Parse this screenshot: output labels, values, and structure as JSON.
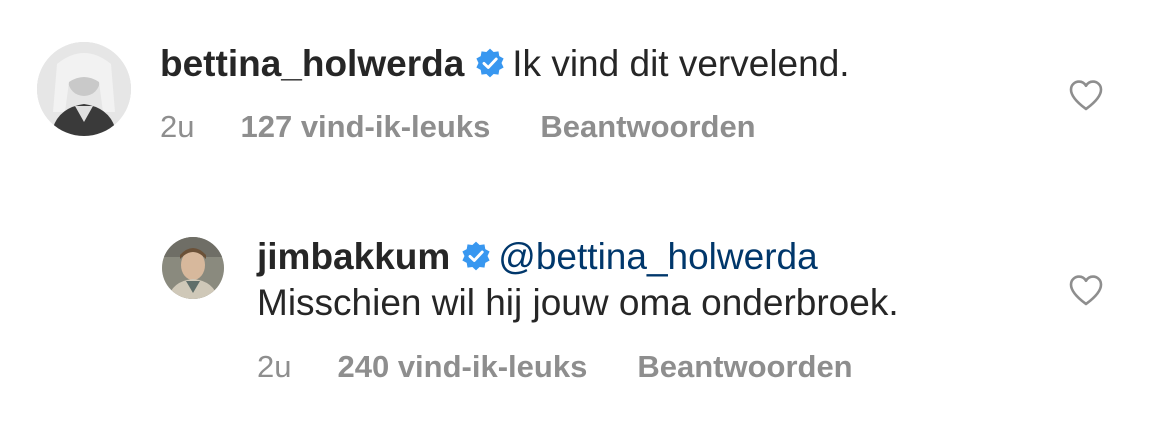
{
  "comments": [
    {
      "username": "bettina_holwerda",
      "verified_icon": "verified-badge-icon",
      "mention": "",
      "text": "Ik vind dit vervelend.",
      "time": "2u",
      "likes": "127 vind-ik-leuks",
      "reply_label": "Beantwoorden",
      "heart_icon": "heart-outline-icon"
    },
    {
      "username": "jimbakkum",
      "verified_icon": "verified-badge-icon",
      "mention": "@bettina_holwerda",
      "text": "Misschien wil hij jouw oma onderbroek.",
      "time": "2u",
      "likes": "240 vind-ik-leuks",
      "reply_label": "Beantwoorden",
      "heart_icon": "heart-outline-icon"
    }
  ],
  "colors": {
    "text": "#262626",
    "secondary": "#8e8e8e",
    "mention": "#00376b",
    "verified": "#3897f0"
  }
}
